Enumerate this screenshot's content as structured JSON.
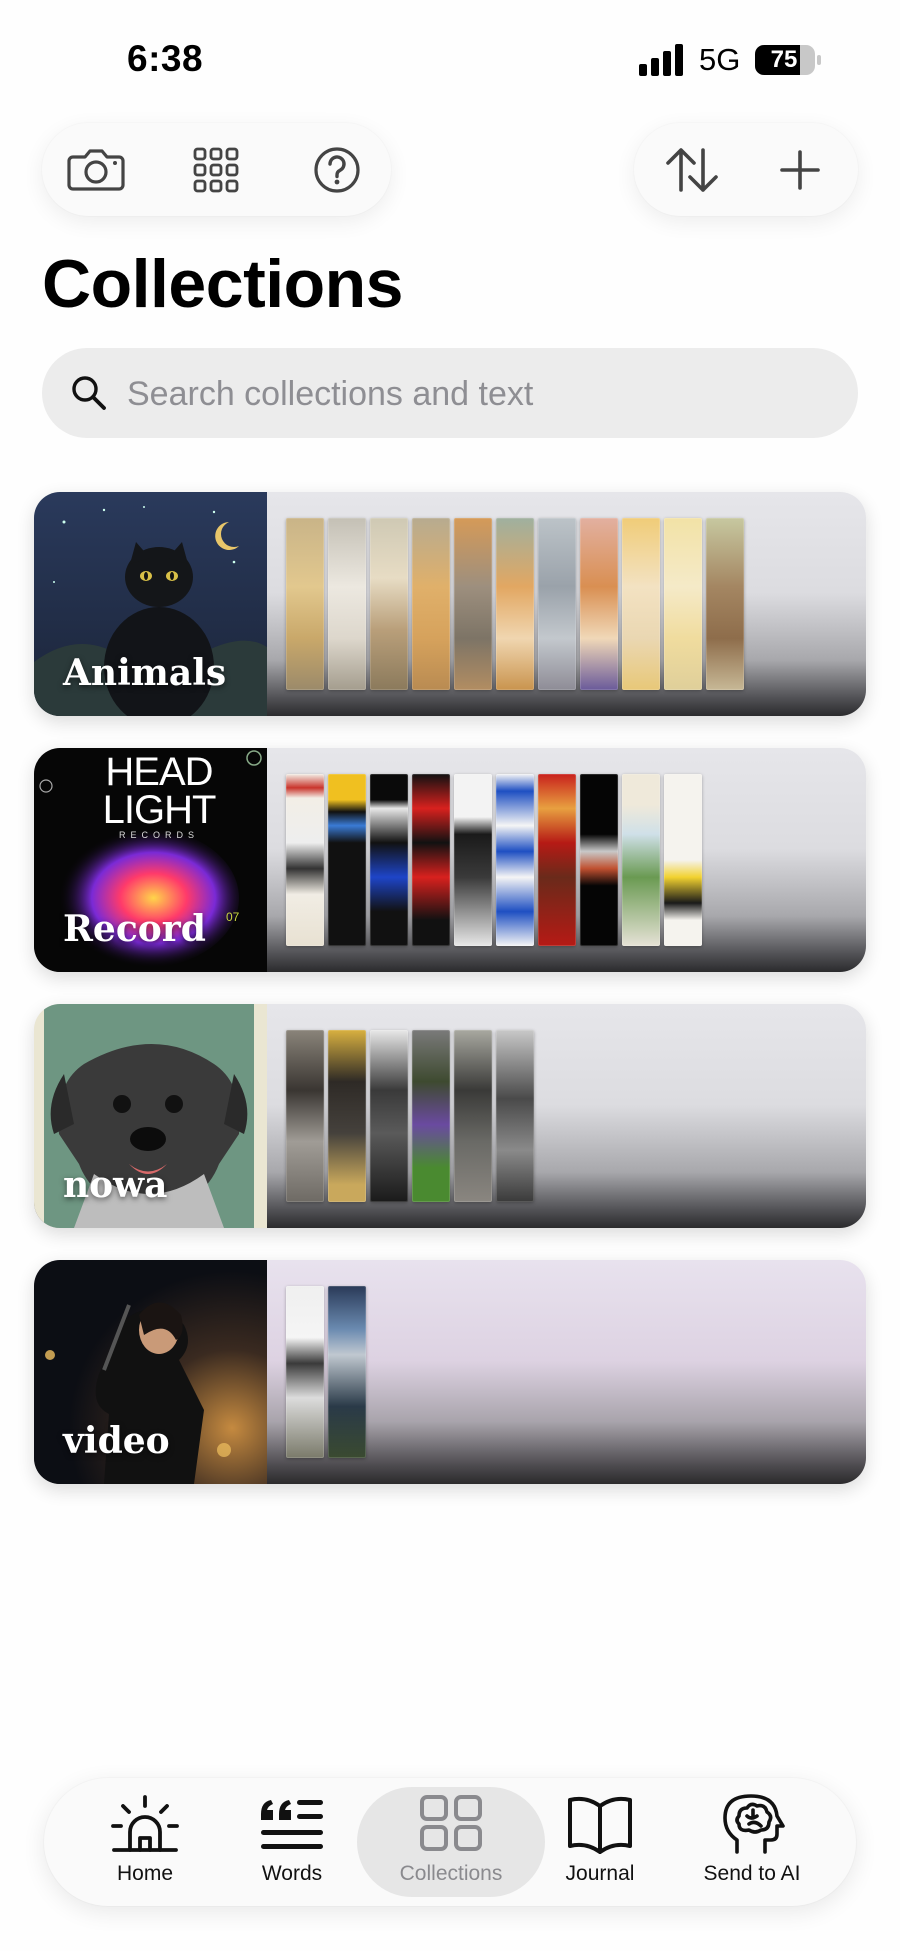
{
  "status_bar": {
    "time": "6:38",
    "network": "5G",
    "battery": "75"
  },
  "page": {
    "title": "Collections"
  },
  "search": {
    "placeholder": "Search collections and text"
  },
  "collections": [
    {
      "label": "Animals"
    },
    {
      "label": "Record"
    },
    {
      "label": "nowa"
    },
    {
      "label": "video"
    }
  ],
  "record_cover": {
    "line1": "HEAD",
    "line2": "LIGHT",
    "line3": "RECORDS",
    "number": "07"
  },
  "tabs": [
    {
      "label": "Home",
      "icon": "lighthouse-icon"
    },
    {
      "label": "Words",
      "icon": "quote-lines-icon"
    },
    {
      "label": "Collections",
      "icon": "grid-icon",
      "active": true
    },
    {
      "label": "Journal",
      "icon": "book-icon"
    },
    {
      "label": "Send to AI",
      "icon": "brain-head-icon"
    }
  ],
  "colors": {
    "accent_active_bg": "#e6e6e6",
    "background": "#fefefe"
  }
}
